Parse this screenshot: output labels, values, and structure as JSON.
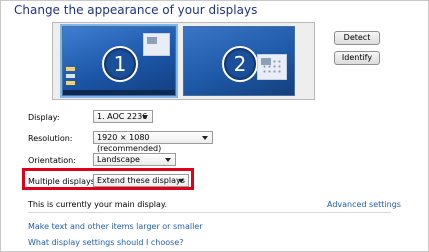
{
  "page": {
    "title": "Change the appearance of your displays"
  },
  "preview": {
    "monitors": [
      {
        "number": "1",
        "selected": true
      },
      {
        "number": "2",
        "selected": false
      }
    ]
  },
  "buttons": {
    "detect": "Detect",
    "identify": "Identify"
  },
  "settings": {
    "display": {
      "label": "Display:",
      "value": "1. AOC 2236"
    },
    "resolution": {
      "label": "Resolution:",
      "value": "1920 × 1080 (recommended)"
    },
    "orientation": {
      "label": "Orientation:",
      "value": "Landscape"
    },
    "multiple": {
      "label": "Multiple displays:",
      "value": "Extend these displays"
    }
  },
  "status_text": "This is currently your main display.",
  "links": {
    "advanced": "Advanced settings",
    "text_size": "Make text and other items larger or smaller",
    "help": "What display settings should I choose?"
  },
  "colors": {
    "title": "#1e3287",
    "link": "#1f5fb0",
    "highlight": "#e0001a"
  }
}
